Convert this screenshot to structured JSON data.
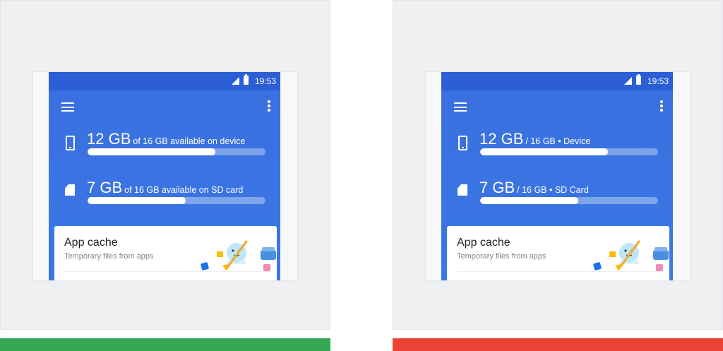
{
  "colors": {
    "good_bar": "#34a853",
    "bad_bar": "#ea4335",
    "screen_blue": "#3b6fe0",
    "statusbar_blue": "#2c5ed6"
  },
  "variants": [
    {
      "status": {
        "time": "19:53"
      },
      "storage": [
        {
          "big": "12 GB",
          "small": "of 16 GB available on device",
          "icon": "phone-icon",
          "fill": 0.72
        },
        {
          "big": "7 GB",
          "small": "of 16 GB available on SD card",
          "icon": "sd-card-icon",
          "fill": 0.55
        }
      ],
      "card": {
        "title": "App cache",
        "subtitle": "Temporary files from apps"
      }
    },
    {
      "status": {
        "time": "19:53"
      },
      "storage": [
        {
          "big": "12 GB",
          "small": "/ 16 GB • Device",
          "icon": "phone-icon",
          "fill": 0.72
        },
        {
          "big": "7 GB",
          "small": "/ 16 GB • SD Card",
          "icon": "sd-card-icon",
          "fill": 0.55
        }
      ],
      "card": {
        "title": "App cache",
        "subtitle": "Temporary files from apps"
      }
    }
  ]
}
